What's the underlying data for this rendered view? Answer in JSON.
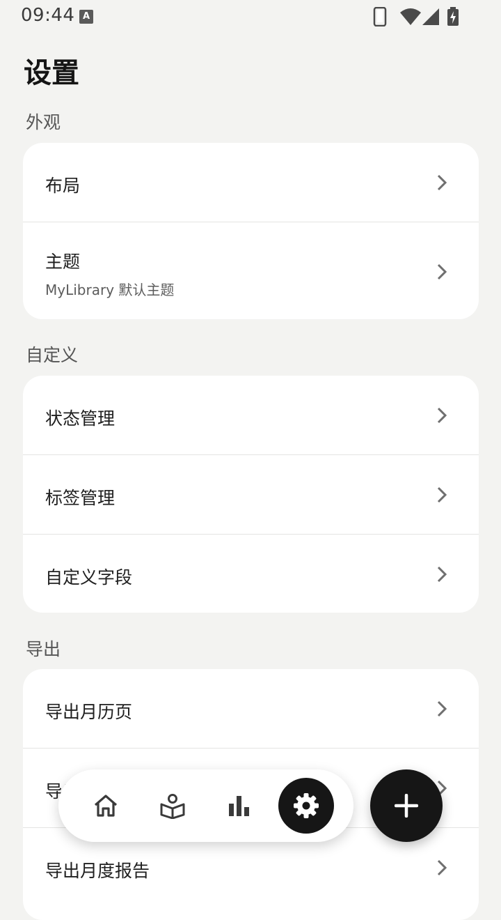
{
  "status_bar": {
    "time": "09:44",
    "notification_badge": "A",
    "icons": [
      "phone-icon",
      "wifi-icon",
      "signal-icon",
      "battery-charging-icon"
    ]
  },
  "page": {
    "title": "设置"
  },
  "sections": {
    "appearance": {
      "header": "外观",
      "layout": {
        "title": "布局"
      },
      "theme": {
        "title": "主题",
        "subtitle": "MyLibrary 默认主题"
      }
    },
    "custom": {
      "header": "自定义",
      "status": {
        "title": "状态管理"
      },
      "tags": {
        "title": "标签管理"
      },
      "fields": {
        "title": "自定义字段"
      }
    },
    "export": {
      "header": "导出",
      "calendar": {
        "title": "导出月历页"
      },
      "second": {
        "title": "导出"
      },
      "report": {
        "title": "导出月度报告"
      }
    }
  },
  "bottom_nav": {
    "items": [
      "home-icon",
      "reading-icon",
      "stats-icon",
      "settings-icon"
    ],
    "active": "settings-icon"
  },
  "fab": {
    "icon": "plus-icon"
  },
  "colors": {
    "background": "#f3f3f1",
    "card": "#ffffff",
    "accent_dark": "#161616",
    "chevron": "#6f6f6f"
  }
}
